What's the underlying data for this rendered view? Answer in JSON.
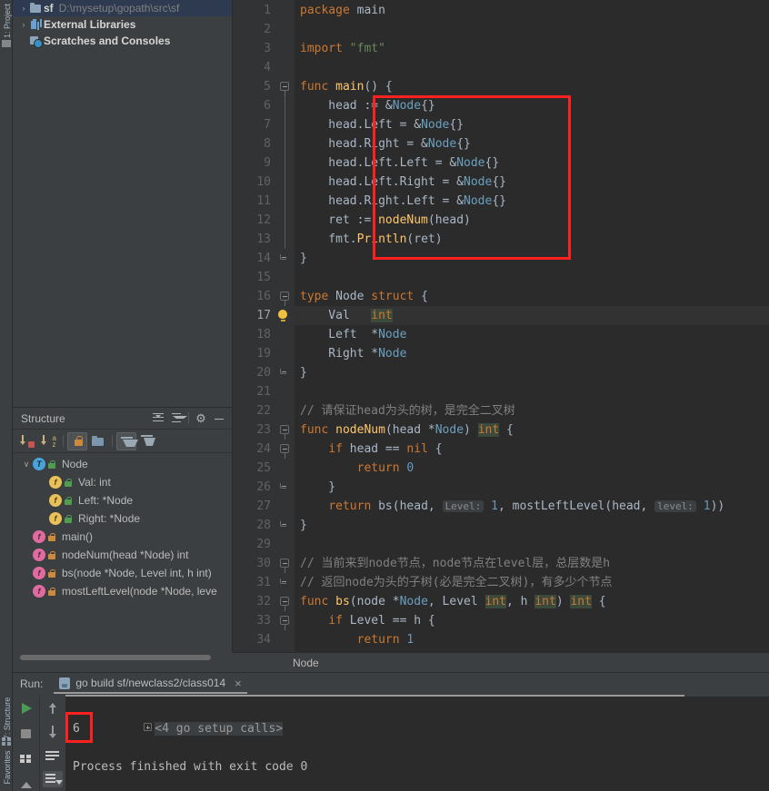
{
  "tool_tabs": {
    "project": "1: Project",
    "structure": "7: Structure",
    "favorites": "Favorites"
  },
  "project_tree": {
    "items": [
      {
        "arrow": "›",
        "icon": "folder-icon",
        "name": "sf",
        "path": "D:\\mysetup\\gopath\\src\\sf",
        "selected": true
      },
      {
        "arrow": "›",
        "icon": "library-icon",
        "name": "External Libraries",
        "path": "",
        "selected": false
      },
      {
        "arrow": "",
        "icon": "scratches-icon",
        "name": "Scratches and Consoles",
        "path": "",
        "selected": false
      }
    ]
  },
  "structure": {
    "title": "Structure",
    "header_icons": [
      "expand-all-icon",
      "collapse-all-icon",
      "gear-icon",
      "minimize-icon"
    ],
    "toolbar_icons": [
      "sort-by-visibility-icon",
      "sort-alphabetically-icon",
      "show-non-public-icon",
      "group-icon",
      "ancestors-icon",
      "descendants-icon"
    ],
    "items": [
      {
        "indent": 0,
        "arrow": "∨",
        "badge": "T",
        "badge_kind": "type",
        "lock": "green",
        "label": "Node"
      },
      {
        "indent": 1,
        "arrow": "",
        "badge": "f",
        "badge_kind": "field",
        "lock": "green",
        "label": "Val: int"
      },
      {
        "indent": 1,
        "arrow": "",
        "badge": "f",
        "badge_kind": "field",
        "lock": "green",
        "label": "Left: *Node"
      },
      {
        "indent": 1,
        "arrow": "",
        "badge": "f",
        "badge_kind": "field",
        "lock": "green",
        "label": "Right: *Node"
      },
      {
        "indent": 0,
        "arrow": "",
        "badge": "f",
        "badge_kind": "func",
        "lock": "orange",
        "label": "main()"
      },
      {
        "indent": 0,
        "arrow": "",
        "badge": "f",
        "badge_kind": "func",
        "lock": "orange",
        "label": "nodeNum(head *Node) int"
      },
      {
        "indent": 0,
        "arrow": "",
        "badge": "f",
        "badge_kind": "func",
        "lock": "orange",
        "label": "bs(node *Node, Level int, h int)"
      },
      {
        "indent": 0,
        "arrow": "",
        "badge": "f",
        "badge_kind": "func",
        "lock": "orange",
        "label": "mostLeftLevel(node *Node, leve"
      }
    ]
  },
  "editor": {
    "breadcrumb": "Node",
    "current_line": 17,
    "lines": [
      {
        "n": 1,
        "tokens": [
          {
            "t": "package ",
            "c": "kw"
          },
          {
            "t": "main",
            "c": "typ"
          }
        ]
      },
      {
        "n": 2,
        "tokens": []
      },
      {
        "n": 3,
        "tokens": [
          {
            "t": "import ",
            "c": "kw"
          },
          {
            "t": "\"fmt\"",
            "c": "str"
          }
        ]
      },
      {
        "n": 4,
        "tokens": []
      },
      {
        "n": 5,
        "tokens": [
          {
            "t": "func ",
            "c": "kw"
          },
          {
            "t": "main",
            "c": "fn"
          },
          {
            "t": "() {",
            "c": "typ"
          }
        ],
        "run": true,
        "fold": "open"
      },
      {
        "n": 6,
        "tokens": [
          {
            "t": "    head := &",
            "c": "typ"
          },
          {
            "t": "Node",
            "c": "ptr"
          },
          {
            "t": "{}",
            "c": "typ"
          }
        ]
      },
      {
        "n": 7,
        "tokens": [
          {
            "t": "    head.Left = &",
            "c": "typ"
          },
          {
            "t": "Node",
            "c": "ptr"
          },
          {
            "t": "{}",
            "c": "typ"
          }
        ]
      },
      {
        "n": 8,
        "tokens": [
          {
            "t": "    head.Right = &",
            "c": "typ"
          },
          {
            "t": "Node",
            "c": "ptr"
          },
          {
            "t": "{}",
            "c": "typ"
          }
        ]
      },
      {
        "n": 9,
        "tokens": [
          {
            "t": "    head.Left.Left = &",
            "c": "typ"
          },
          {
            "t": "Node",
            "c": "ptr"
          },
          {
            "t": "{}",
            "c": "typ"
          }
        ]
      },
      {
        "n": 10,
        "tokens": [
          {
            "t": "    head.Left.Right = &",
            "c": "typ"
          },
          {
            "t": "Node",
            "c": "ptr"
          },
          {
            "t": "{}",
            "c": "typ"
          }
        ]
      },
      {
        "n": 11,
        "tokens": [
          {
            "t": "    head.Right.Left = &",
            "c": "typ"
          },
          {
            "t": "Node",
            "c": "ptr"
          },
          {
            "t": "{}",
            "c": "typ"
          }
        ]
      },
      {
        "n": 12,
        "tokens": [
          {
            "t": "    ret := ",
            "c": "typ"
          },
          {
            "t": "nodeNum",
            "c": "fn"
          },
          {
            "t": "(head)",
            "c": "typ"
          }
        ]
      },
      {
        "n": 13,
        "tokens": [
          {
            "t": "    fmt.",
            "c": "typ"
          },
          {
            "t": "Println",
            "c": "fn"
          },
          {
            "t": "(ret)",
            "c": "typ"
          }
        ]
      },
      {
        "n": 14,
        "tokens": [
          {
            "t": "}",
            "c": "typ"
          }
        ],
        "fold": "end"
      },
      {
        "n": 15,
        "tokens": []
      },
      {
        "n": 16,
        "tokens": [
          {
            "t": "type ",
            "c": "kw"
          },
          {
            "t": "Node ",
            "c": "typ"
          },
          {
            "t": "struct",
            "c": "kw"
          },
          {
            "t": " {",
            "c": "typ"
          }
        ],
        "fold": "open"
      },
      {
        "n": 17,
        "tokens": [
          {
            "t": "    Val   ",
            "c": "typ"
          },
          {
            "t": "int",
            "c": "bltin"
          }
        ],
        "bulb": true,
        "highlight": true
      },
      {
        "n": 18,
        "tokens": [
          {
            "t": "    Left  *",
            "c": "typ"
          },
          {
            "t": "Node",
            "c": "ptr"
          }
        ]
      },
      {
        "n": 19,
        "tokens": [
          {
            "t": "    Right *",
            "c": "typ"
          },
          {
            "t": "Node",
            "c": "ptr"
          }
        ]
      },
      {
        "n": 20,
        "tokens": [
          {
            "t": "}",
            "c": "typ"
          }
        ],
        "fold": "end"
      },
      {
        "n": 21,
        "tokens": []
      },
      {
        "n": 22,
        "tokens": [
          {
            "t": "// 请保证head为头的树，是完全二叉树",
            "c": "cmt"
          }
        ]
      },
      {
        "n": 23,
        "tokens": [
          {
            "t": "func ",
            "c": "kw"
          },
          {
            "t": "nodeNum",
            "c": "fn"
          },
          {
            "t": "(head *",
            "c": "typ"
          },
          {
            "t": "Node",
            "c": "ptr"
          },
          {
            "t": ") ",
            "c": "typ"
          },
          {
            "t": "int",
            "c": "bltin"
          },
          {
            "t": " {",
            "c": "typ"
          }
        ],
        "fold": "open"
      },
      {
        "n": 24,
        "tokens": [
          {
            "t": "    ",
            "c": "typ"
          },
          {
            "t": "if ",
            "c": "kw"
          },
          {
            "t": "head == ",
            "c": "typ"
          },
          {
            "t": "nil",
            "c": "kw"
          },
          {
            "t": " {",
            "c": "typ"
          }
        ],
        "fold": "open"
      },
      {
        "n": 25,
        "tokens": [
          {
            "t": "        ",
            "c": "typ"
          },
          {
            "t": "return ",
            "c": "kw"
          },
          {
            "t": "0",
            "c": "num"
          }
        ]
      },
      {
        "n": 26,
        "tokens": [
          {
            "t": "    }",
            "c": "typ"
          }
        ],
        "fold": "end"
      },
      {
        "n": 27,
        "tokens": [
          {
            "t": "    ",
            "c": "typ"
          },
          {
            "t": "return ",
            "c": "kw"
          },
          {
            "t": "bs",
            "c": "typ"
          },
          {
            "t": "(head, ",
            "c": "typ"
          },
          {
            "t": "Level:",
            "c": "hint"
          },
          {
            "t": " ",
            "c": "typ"
          },
          {
            "t": "1",
            "c": "num"
          },
          {
            "t": ", ",
            "c": "typ"
          },
          {
            "t": "mostLeftLevel",
            "c": "typ"
          },
          {
            "t": "(head, ",
            "c": "typ"
          },
          {
            "t": "level:",
            "c": "hint"
          },
          {
            "t": " ",
            "c": "typ"
          },
          {
            "t": "1",
            "c": "num"
          },
          {
            "t": "))",
            "c": "typ"
          }
        ]
      },
      {
        "n": 28,
        "tokens": [
          {
            "t": "}",
            "c": "typ"
          }
        ],
        "fold": "end"
      },
      {
        "n": 29,
        "tokens": []
      },
      {
        "n": 30,
        "tokens": [
          {
            "t": "// 当前来到node节点，node节点在level层，总层数是h",
            "c": "cmt"
          }
        ],
        "fold": "open"
      },
      {
        "n": 31,
        "tokens": [
          {
            "t": "// 返回node为头的子树(必是完全二叉树)，有多少个节点",
            "c": "cmt"
          }
        ],
        "fold": "end"
      },
      {
        "n": 32,
        "tokens": [
          {
            "t": "func ",
            "c": "kw"
          },
          {
            "t": "bs",
            "c": "fn"
          },
          {
            "t": "(node *",
            "c": "typ"
          },
          {
            "t": "Node",
            "c": "ptr"
          },
          {
            "t": ", Level ",
            "c": "typ"
          },
          {
            "t": "int",
            "c": "bltin"
          },
          {
            "t": ", h ",
            "c": "typ"
          },
          {
            "t": "int",
            "c": "bltin"
          },
          {
            "t": ") ",
            "c": "typ"
          },
          {
            "t": "int",
            "c": "bltin"
          },
          {
            "t": " {",
            "c": "typ"
          }
        ],
        "fold": "open"
      },
      {
        "n": 33,
        "tokens": [
          {
            "t": "    ",
            "c": "typ"
          },
          {
            "t": "if ",
            "c": "kw"
          },
          {
            "t": "Level == h {",
            "c": "typ"
          }
        ],
        "fold": "open"
      },
      {
        "n": 34,
        "tokens": [
          {
            "t": "        ",
            "c": "typ"
          },
          {
            "t": "return ",
            "c": "kw"
          },
          {
            "t": "1",
            "c": "num"
          }
        ]
      }
    ]
  },
  "run_panel": {
    "label": "Run:",
    "tab_title": "go build sf/newclass2/class014",
    "close": "×",
    "toolbar_icons": [
      "run-icon",
      "stop-icon",
      "grid-icon",
      "scroll-up-icon",
      "scroll-down-icon",
      "soft-wrap-icon",
      "scroll-to-end-icon",
      "collapse-icon"
    ],
    "console": {
      "setup_calls": "<4 go setup calls>",
      "output_value": "6",
      "exit_message": "Process finished with exit code 0"
    }
  },
  "annotations": {
    "code_box_color": "#ff2020",
    "output_box_color": "#ff2020"
  }
}
